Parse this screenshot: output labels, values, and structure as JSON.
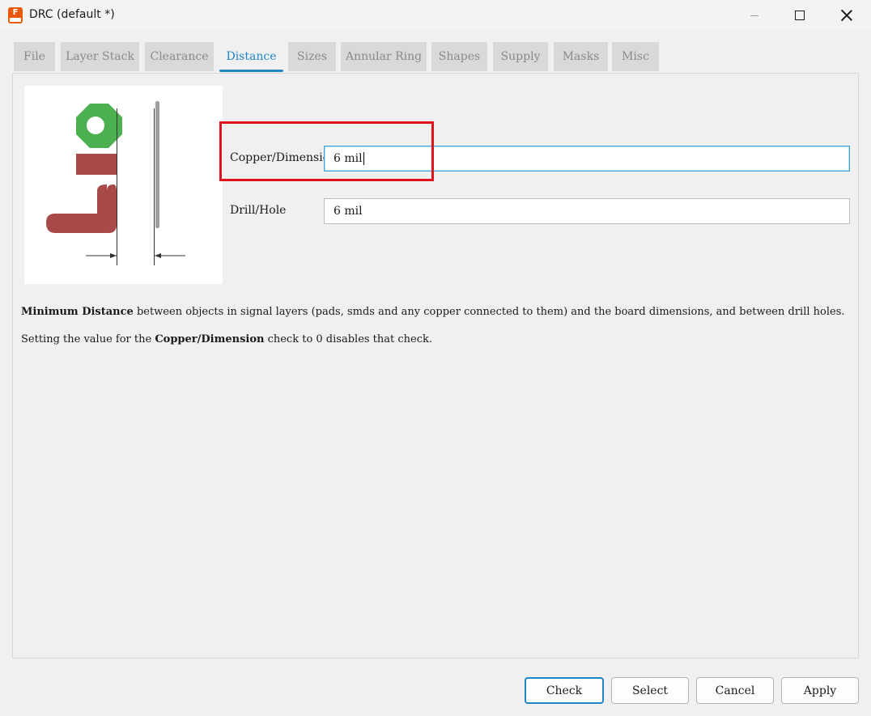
{
  "window": {
    "title": "DRC (default *)",
    "app_icon_letter": "F"
  },
  "tabs": [
    {
      "label": "File",
      "active": false
    },
    {
      "label": "Layer Stack",
      "active": false
    },
    {
      "label": "Clearance",
      "active": false
    },
    {
      "label": "Distance",
      "active": true
    },
    {
      "label": "Sizes",
      "active": false
    },
    {
      "label": "Annular Ring",
      "active": false
    },
    {
      "label": "Shapes",
      "active": false
    },
    {
      "label": "Supply",
      "active": false
    },
    {
      "label": "Masks",
      "active": false
    },
    {
      "label": "Misc",
      "active": false
    }
  ],
  "fields": {
    "copper_dimension": {
      "label": "Copper/Dimension",
      "value": "6 mil"
    },
    "drill_hole": {
      "label": "Drill/Hole",
      "value": "6 mil"
    }
  },
  "description": {
    "line1_bold": "Minimum Distance",
    "line1_rest": " between objects in signal layers (pads, smds and any copper connected to them) and the board dimensions, and between drill holes.",
    "line2_start": "Setting the value for the ",
    "line2_bold": "Copper/Dimension",
    "line2_end": " check to 0 disables that check."
  },
  "buttons": {
    "check": "Check",
    "select": "Select",
    "cancel": "Cancel",
    "apply": "Apply"
  },
  "colors": {
    "accent": "#1f86c8",
    "highlight": "#e0141e",
    "pad_green": "#4caf50",
    "copper_red": "#a84a4a"
  }
}
